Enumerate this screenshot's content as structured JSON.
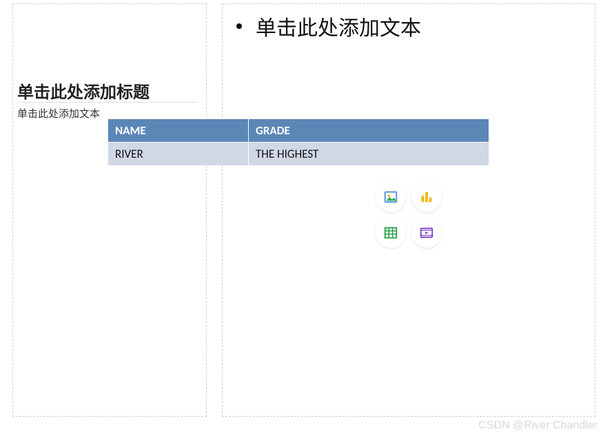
{
  "left": {
    "title_placeholder": "单击此处添加标题",
    "text_placeholder": "单击此处添加文本"
  },
  "right": {
    "bullet_placeholder": "单击此处添加文本"
  },
  "table": {
    "headers": [
      "NAME",
      "GRADE"
    ],
    "rows": [
      [
        "RIVER",
        "THE HIGHEST"
      ]
    ]
  },
  "insert_icons": {
    "picture": "picture-icon",
    "chart": "chart-icon",
    "table": "table-icon",
    "video": "video-icon"
  },
  "watermark": "CSDN @River Chandler"
}
